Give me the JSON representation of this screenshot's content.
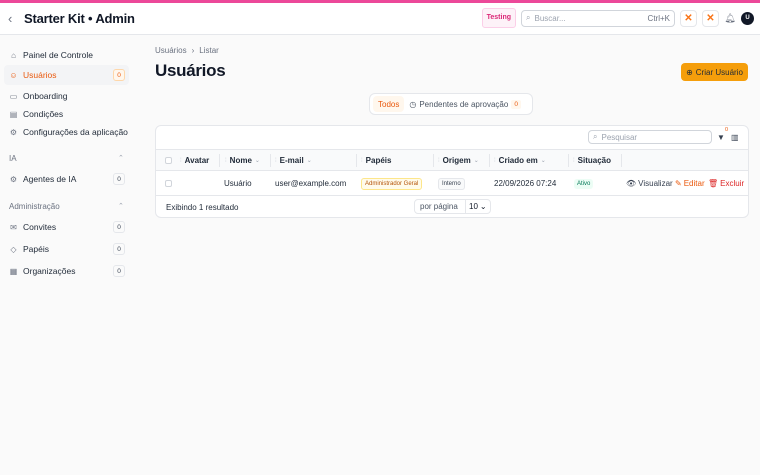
{
  "header": {
    "title": "Starter Kit • Admin",
    "environment_badge": "Testing",
    "search_placeholder": "Buscar...",
    "search_shortcut": "Ctrl+K",
    "avatar_initial": "U"
  },
  "sidebar": {
    "items": [
      {
        "label": "Painel de Controle",
        "icon": "grid-icon"
      },
      {
        "label": "Usuários",
        "icon": "users-icon",
        "count": "0",
        "active": true
      },
      {
        "label": "Onboarding",
        "icon": "book-icon"
      },
      {
        "label": "Condições",
        "icon": "document-icon"
      },
      {
        "label": "Configurações da aplicação",
        "icon": "gear-icon"
      }
    ],
    "sections": [
      {
        "label": "IA",
        "items": [
          {
            "label": "Agentes de IA",
            "icon": "bot-icon",
            "count": "0"
          }
        ]
      },
      {
        "label": "Administração",
        "items": [
          {
            "label": "Convites",
            "icon": "mail-icon",
            "count": "0"
          },
          {
            "label": "Papéis",
            "icon": "shield-icon",
            "count": "0"
          },
          {
            "label": "Organizações",
            "icon": "building-icon",
            "count": "0"
          }
        ]
      }
    ]
  },
  "main": {
    "breadcrumb": [
      "Usuários",
      "Listar"
    ],
    "title": "Usuários",
    "create_button": "Criar Usuário",
    "tabs": [
      {
        "label": "Todos",
        "active": true
      },
      {
        "label": "Pendentes de aprovação",
        "count": "0"
      }
    ],
    "table": {
      "search_placeholder": "Pesquisar",
      "filter_count": "0",
      "columns": [
        "Avatar",
        "Nome",
        "E-mail",
        "Papéis",
        "Origem",
        "Criado em",
        "Situação"
      ],
      "rows": [
        {
          "name": "Usuário",
          "email": "user@example.com",
          "role": "Administrador Geral",
          "origin": "Interno",
          "created_at": "22/09/2026 07:24",
          "status": "Ativo",
          "actions": [
            "Visualizar",
            "Editar",
            "Excluir"
          ]
        }
      ],
      "footer": {
        "result_text": "Exibindo 1 resultado",
        "per_page_label": "por página",
        "per_page_value": "10"
      }
    }
  },
  "colors": {
    "accent": "#ea580c",
    "topline": "#ec4899",
    "primary_button": "#f59e0b"
  }
}
